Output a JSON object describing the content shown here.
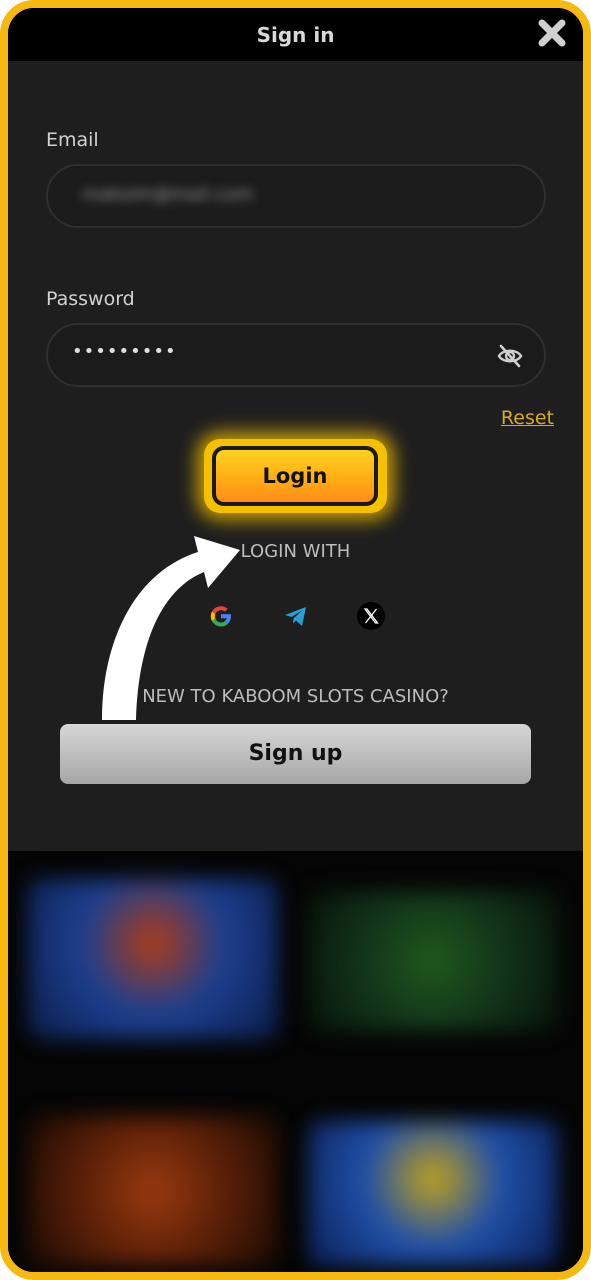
{
  "header": {
    "title": "Sign in",
    "close_icon": "close-icon"
  },
  "form": {
    "email_label": "Email",
    "email_value": "maksim@mail.com",
    "password_label": "Password",
    "password_value": "•••••••••",
    "password_toggle_icon": "eye-slash-icon",
    "reset_label": "Reset",
    "login_label": "Login"
  },
  "social": {
    "heading": "LOGIN WITH",
    "providers": [
      {
        "name": "Google",
        "icon": "google-icon"
      },
      {
        "name": "Telegram",
        "icon": "telegram-icon"
      },
      {
        "name": "X",
        "icon": "x-icon"
      }
    ]
  },
  "signup": {
    "prompt": "NEW TO KABOOM SLOTS CASINO?",
    "button_label": "Sign up"
  },
  "colors": {
    "frame": "#f7b90f",
    "accent": "#ffb514",
    "link": "#d9a824",
    "panel": "#1e1e1e"
  }
}
